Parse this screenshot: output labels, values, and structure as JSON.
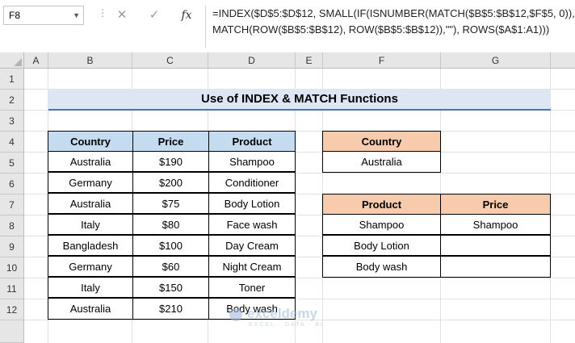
{
  "formula_bar": {
    "name_box": "F8",
    "cancel_glyph": "✕",
    "enter_glyph": "✓",
    "fx_glyph": "fx",
    "formula_line1": "=INDEX($D$5:$D$12, SMALL(IF(ISNUMBER(MATCH($B$5:$B$12,$F$5, 0)),",
    "formula_line2": "MATCH(ROW($B$5:$B$12), ROW($B$5:$B$12)),\"\"), ROWS($A$1:A1)))"
  },
  "columns": [
    "A",
    "B",
    "C",
    "D",
    "E",
    "F",
    "G"
  ],
  "rows": [
    "1",
    "2",
    "3",
    "4",
    "5",
    "6",
    "7",
    "8",
    "9",
    "10",
    "11",
    "12"
  ],
  "title": "Use of INDEX & MATCH Functions",
  "data_table": {
    "headers": [
      "Country",
      "Price",
      "Product"
    ],
    "rows": [
      [
        "Australia",
        "$190",
        "Shampoo"
      ],
      [
        "Germany",
        "$200",
        "Conditioner"
      ],
      [
        "Australia",
        "$75",
        "Body Lotion"
      ],
      [
        "Italy",
        "$80",
        "Face wash"
      ],
      [
        "Bangladesh",
        "$100",
        "Day Cream"
      ],
      [
        "Germany",
        "$60",
        "Night Cream"
      ],
      [
        "Italy",
        "$150",
        "Toner"
      ],
      [
        "Australia",
        "$210",
        "Body wash"
      ]
    ]
  },
  "criteria": {
    "header": "Country",
    "value": "Australia"
  },
  "result_table": {
    "headers": [
      "Product",
      "Price"
    ],
    "rows": [
      [
        "Shampoo",
        "Shampoo"
      ],
      [
        "Body Lotion",
        ""
      ],
      [
        "Body wash",
        ""
      ]
    ]
  },
  "watermark": {
    "name": "exceldemy",
    "tagline": "EXCEL · DATA · BI"
  },
  "colors": {
    "header_blue": "#c5dcf0",
    "header_peach": "#f8cbad",
    "title_fill": "#dde6f2",
    "title_underline": "#4472c4"
  }
}
